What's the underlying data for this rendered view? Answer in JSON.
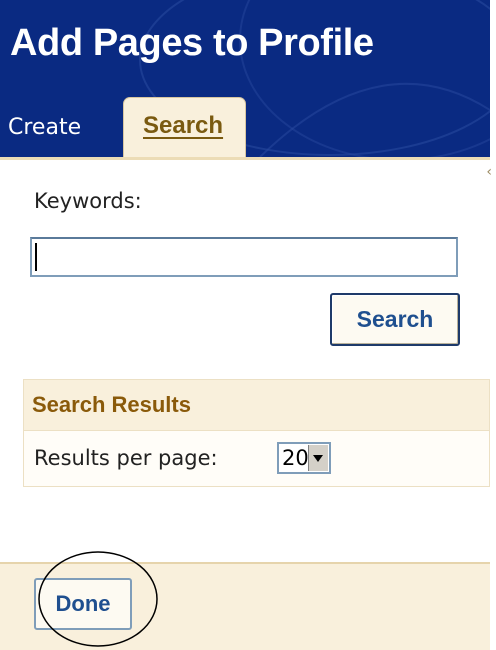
{
  "header": {
    "title": "Add Pages to Profile"
  },
  "tabs": {
    "create_label": "Create",
    "search_label": "Search",
    "active": "Search"
  },
  "search_form": {
    "keywords_label": "Keywords:",
    "keywords_value": "",
    "search_button_label": "Search"
  },
  "search_results": {
    "title": "Search Results",
    "results_per_page_label": "Results per page:",
    "results_per_page_value": "20"
  },
  "footer": {
    "done_button_label": "Done"
  },
  "colors": {
    "header_bg": "#0a2a82",
    "panel_accent": "#f9f0dc",
    "tab_text": "#7a5a10",
    "results_title": "#8a5a0a",
    "button_text": "#1f4f8f"
  },
  "icons": {
    "scroll_arrow": "chevron-left-icon",
    "select_arrow": "chevron-down-icon"
  }
}
